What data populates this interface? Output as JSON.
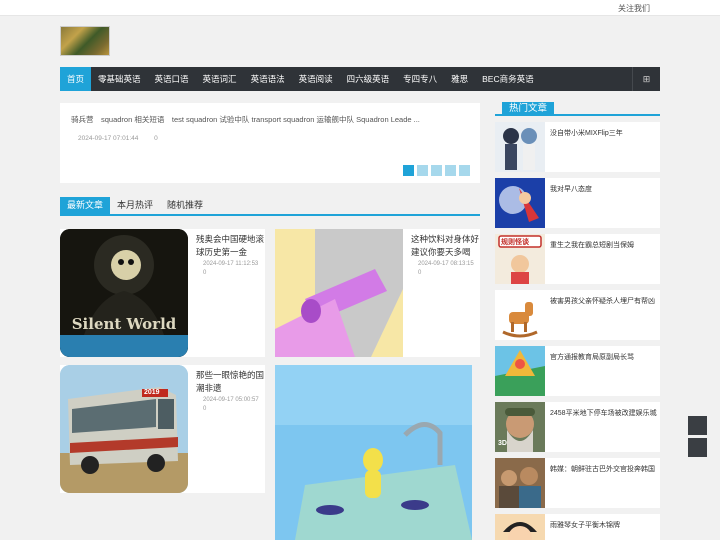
{
  "topbar": {
    "follow": "关注我们"
  },
  "nav": {
    "items": [
      "首页",
      "零基础英语",
      "英语口语",
      "英语词汇",
      "英语语法",
      "英语阅读",
      "四六级英语",
      "专四专八",
      "雅思",
      "BEC商务英语"
    ],
    "grid_icon": "⊞"
  },
  "slider": {
    "title": "骑兵营　squadron 相关短语　test squadron 试验中队 transport squadron 运输舰中队 Squadron Leade ...",
    "date": "2024-09-17 07:01:44",
    "views": "0"
  },
  "tabs": [
    "最新文章",
    "本月热评",
    "随机推荐"
  ],
  "cards": [
    {
      "title": "残奥会中国硬地滚球历史第一金",
      "date": "2024-09-17 11:12:53",
      "views": "0",
      "thumb_text": "Silent World"
    },
    {
      "title": "这种饮料对身体好建议你要天多喝",
      "date": "2024-09-17 08:13:15",
      "views": "0"
    },
    {
      "title": "那些一眼惊艳的国潮非遗",
      "date": "2024-09-17 05:00:57",
      "views": "0",
      "thumb_text": "2019"
    },
    {
      "title": "",
      "date": "",
      "views": ""
    }
  ],
  "sidebar": {
    "heading": "热门文章",
    "items": [
      {
        "text": "没自带小米MIXFlip三年"
      },
      {
        "text": "我对早八态度"
      },
      {
        "text": "重生之我在霸总短剧当保姆",
        "thumb_text": "规则怪谈"
      },
      {
        "text": "被害男孩父亲怀疑杀人埋尸有帮凶"
      },
      {
        "text": "官方通报教育局原副局长骂"
      },
      {
        "text": "2458平米地下停车场被改建娱乐城",
        "thumb_text": "3D"
      },
      {
        "text": "韩媒：朝鲜驻古巴外交官投奔韩国"
      },
      {
        "text": "雨雅琴女子平衡木锦牌"
      }
    ]
  },
  "colors": {
    "accent": "#1fa3d8",
    "nav_bg": "#2f3338"
  }
}
